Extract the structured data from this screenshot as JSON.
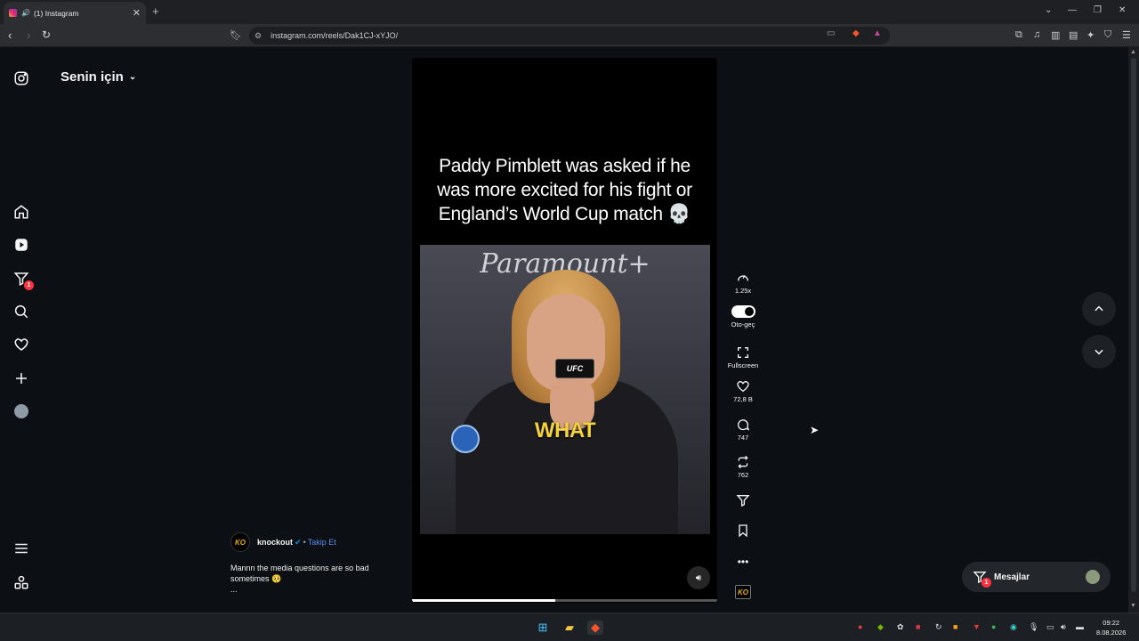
{
  "browser": {
    "tab_title": "(1) Instagram",
    "tab_speaker": "🔊",
    "tab_close": "✕",
    "new_tab": "+",
    "url": "instagram.com/reels/Dak1CJ-xYJO/"
  },
  "sidebar": {
    "feed_title": "Senin için",
    "notifications_badge": "1"
  },
  "reel": {
    "caption_line1": "Paddy Pimblett was asked if he",
    "caption_line2": "was more excited for his fight or",
    "caption_line3": "England’s World Cup match 💀",
    "brand_text": "Paramount+",
    "mic_text": "UFC",
    "subtitle_word": "WHAT",
    "progress": 0.47
  },
  "actions": {
    "speed_label": "1.25x",
    "autoplay_label": "Oto-geç",
    "fullscreen_label": "Fullscreen",
    "likes": "72,8 B",
    "comments": "747",
    "reposts": "762",
    "creator_logo": "KO"
  },
  "author": {
    "name": "knockout",
    "dot": "•",
    "follow": "Takip Et",
    "caption_line1": "Mannn the media questions are so bad",
    "caption_line2": "sometimes 🥺",
    "more": "..."
  },
  "messages": {
    "label": "Mesajlar",
    "badge": "1"
  },
  "taskbar": {
    "time": "09:22",
    "date": "8.08.2026"
  }
}
